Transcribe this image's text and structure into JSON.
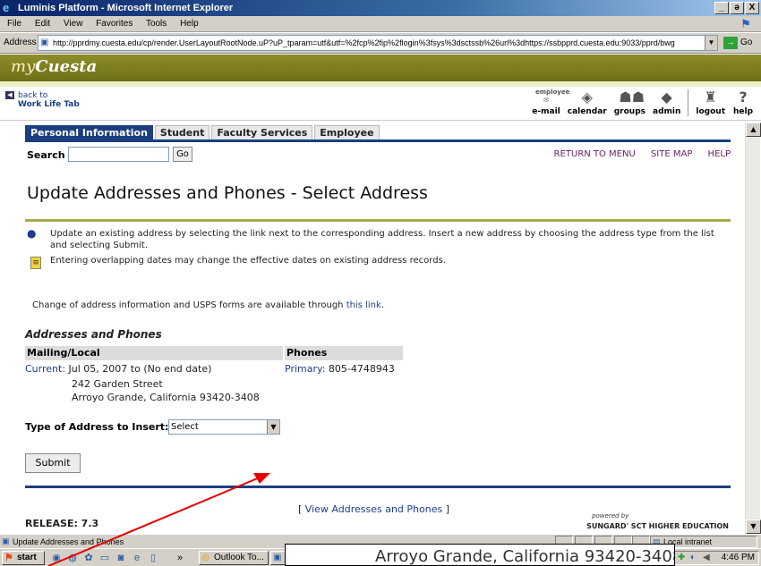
{
  "window": {
    "title": "Luminis Platform - Microsoft Internet Explorer",
    "btn_min": "_",
    "btn_max": "ə",
    "btn_close": "X"
  },
  "menu": [
    "File",
    "Edit",
    "View",
    "Favorites",
    "Tools",
    "Help"
  ],
  "address": {
    "label": "Address",
    "url": "http://pprdmy.cuesta.edu/cp/render.UserLayoutRootNode.uP?uP_tparam=utf&utf=%2fcp%2fip%2flogin%3fsys%3dsctssb%26url%3dhttps://ssbpprd.cuesta.edu:9033/pprd/bwg",
    "go_label": "Go"
  },
  "portal": {
    "brand_my": "my",
    "brand_name": "Cuesta",
    "back_line1": "back to",
    "back_line2": "Work Life Tab",
    "tools": [
      {
        "label": "e-mail",
        "icon": "employee-mail-icon",
        "icon_text": "employee"
      },
      {
        "label": "calendar",
        "icon": "calendar-icon"
      },
      {
        "label": "groups",
        "icon": "groups-icon"
      },
      {
        "label": "admin",
        "icon": "admin-icon"
      },
      {
        "label": "logout",
        "icon": "logout-icon"
      },
      {
        "label": "help",
        "icon": "help-icon"
      }
    ]
  },
  "tabs": [
    "Personal Information",
    "Student",
    "Faculty Services",
    "Employee"
  ],
  "search": {
    "label": "Search",
    "value": "",
    "go_label": "Go"
  },
  "toplinks": [
    "RETURN TO MENU",
    "SITE MAP",
    "HELP"
  ],
  "page": {
    "title": "Update Addresses and Phones - Select Address",
    "info1": "Update an existing address by selecting the link next to the corresponding address. Insert a new address by choosing the address type from the list and selecting Submit.",
    "info2": "Entering overlapping dates may change the effective dates on existing address records.",
    "change_text": "Change of address information and USPS forms are available through ",
    "change_link": "this link",
    "change_end": ".",
    "section_title": "Addresses and Phones",
    "col_mailing": "Mailing/Local",
    "col_phones": "Phones",
    "current_link": "Current:",
    "current_dates": " Jul 05, 2007 to (No end date)",
    "street": "242 Garden Street",
    "city_line": "Arroyo Grande, California   93420-3408",
    "primary_link": "Primary:",
    "primary_phone": " 805-4748943",
    "type_label": "Type of Address to Insert:",
    "type_value": "Select",
    "submit_label": "Submit",
    "view_pre": "[ ",
    "view_link": "View Addresses and Phones",
    "view_post": " ]",
    "release": "RELEASE: 7.3",
    "powered_by": "powered by",
    "sungard": "SUNGARD' SCT HIGHER EDUCATION"
  },
  "status": {
    "text": "Update Addresses and Phones",
    "zone": "Local intranet"
  },
  "taskbar": {
    "start": "start",
    "more": "»",
    "task_outlook": "Outlook To...",
    "clock": "4:46 PM"
  },
  "overlay": {
    "text": "Arroyo Grande, California   93420-3408"
  }
}
